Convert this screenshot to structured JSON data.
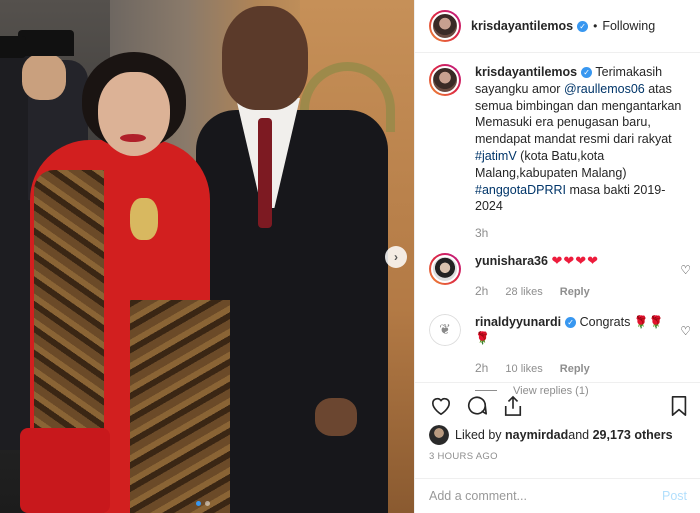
{
  "post": {
    "username": "krisdayantilemos",
    "follow_state": "Following",
    "separator": "•"
  },
  "caption": {
    "username": "krisdayantilemos",
    "text_1": "Terimakasih sayangku amor ",
    "mention": "@raullemos06",
    "text_2": " atas semua bimbingan dan mengantarkan Memasuki era penugasan baru, mendapat mandat resmi dari rakyat ",
    "hashtag_1": "#jatimV",
    "text_3": " (kota Batu,kota Malang,kabupaten Malang) ",
    "hashtag_2": "#anggotaDPRRI",
    "text_4": " masa bakti 2019-2024",
    "time": "3h"
  },
  "comments": [
    {
      "username": "yunishara36",
      "text": "❤❤❤❤",
      "time": "2h",
      "likes": "28 likes",
      "reply": "Reply"
    },
    {
      "username": "rinaldyyunardi",
      "text": "Congrats ",
      "emoji": "🌹🌹🌹",
      "time": "2h",
      "likes": "10 likes",
      "reply": "Reply",
      "view_replies": "View replies (1)"
    }
  ],
  "likes": {
    "prefix": "Liked by ",
    "user": "naymirdad",
    "middle": " and ",
    "count": "29,173 others"
  },
  "time_ago": "3 HOURS AGO",
  "add_comment": {
    "placeholder": "Add a comment...",
    "post": "Post"
  },
  "icons": {
    "verified": "verified-badge-icon",
    "heart": "heart-icon",
    "comment": "comment-icon",
    "share": "share-icon",
    "bookmark": "bookmark-icon",
    "next": "chevron-right-icon"
  },
  "colors": {
    "link": "#003569",
    "verified": "#3897f0",
    "post_disabled": "#b2dffc",
    "muted": "#8e8e8e"
  }
}
